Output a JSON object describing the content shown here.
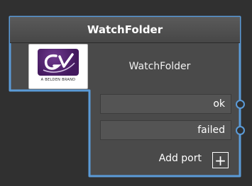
{
  "node": {
    "title": "WatchFolder",
    "label": "WatchFolder",
    "logo": {
      "icon": "gv-logo",
      "text": "A BELDEN BRAND",
      "colors": {
        "mark": "#4b1f66",
        "swoosh": "#ffffff"
      }
    },
    "ports": [
      {
        "label": "ok",
        "connector_icon": "circle-connector"
      },
      {
        "label": "failed",
        "connector_icon": "circle-connector"
      }
    ],
    "add_port": {
      "label": "Add port",
      "icon": "plus-icon",
      "glyph": "+"
    }
  },
  "colors": {
    "canvas": "#303030",
    "node_body": "#4a4a4a",
    "header": "#515151",
    "selection_outline": "#5b9bd8",
    "port_background": "#545454",
    "text": "#ffffff"
  }
}
